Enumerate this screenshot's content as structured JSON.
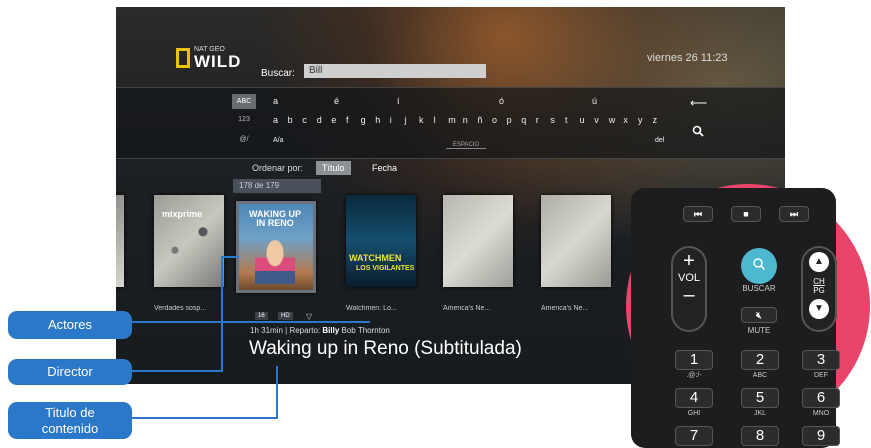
{
  "tv": {
    "channel_logo": {
      "small": "NAT GEO",
      "big": "WILD"
    },
    "search": {
      "label": "Buscar:",
      "value": "Bill"
    },
    "clock": "viernes 26  11:23",
    "keyboard": {
      "modes": [
        "ABC",
        "123",
        "@/"
      ],
      "row1": [
        "a",
        "é",
        "í",
        "ó",
        "ú"
      ],
      "row2": [
        "a",
        "b",
        "c",
        "d",
        "e",
        "f",
        "g",
        "h",
        "i",
        "j",
        "k",
        "l",
        "m",
        "n",
        "ñ",
        "o",
        "p",
        "q",
        "r",
        "s",
        "t",
        "u",
        "v",
        "w",
        "x",
        "y",
        "z"
      ],
      "row3_left": "A/a",
      "space_label": "ESPACIO",
      "row3_right": "del",
      "backspace_icon": "backspace-arrow-icon",
      "search_icon": "magnifier-icon"
    },
    "sort": {
      "label": "Ordenar por:",
      "options": [
        "Título",
        "Fecha"
      ],
      "selected": "Título"
    },
    "rail": {
      "counter": "178 de 179",
      "items": [
        {
          "title": "",
          "poster_text": ""
        },
        {
          "title": "Verdades sosp...",
          "poster_text": "mixprime"
        },
        {
          "title": "",
          "poster_text": "WAKING UP IN RENO"
        },
        {
          "title": "Watchmen: Lo...",
          "poster_text": "WATCHMEN",
          "poster_sub": "LOS VIGILANTES"
        },
        {
          "title": "America's Ne...",
          "poster_text": ""
        },
        {
          "title": "America's Ne...",
          "poster_text": ""
        },
        {
          "title": "",
          "poster_text": ""
        }
      ],
      "badges": [
        "16",
        "HD"
      ]
    },
    "details": {
      "duration": "1h 31min",
      "cast_label": "Reparto:",
      "cast_highlight": "Billy",
      "cast_rest": "Bob Thornton",
      "title": "Waking up in Reno (Subtitulada)"
    }
  },
  "remote": {
    "transport": {
      "rewind": "⏮",
      "stop": "■",
      "forward": "⏭"
    },
    "vol": {
      "plus": "+",
      "label": "VOL",
      "minus": "–"
    },
    "search": {
      "icon": "search-icon",
      "label": "BUSCAR"
    },
    "mute": {
      "icon": "mute-icon",
      "label": "MUTE"
    },
    "ch": {
      "up": "▲",
      "label_top": "CH",
      "label_bottom": "PG",
      "down": "▼"
    },
    "keys": [
      {
        "num": "1",
        "sub": ".@:/-"
      },
      {
        "num": "2",
        "sub": "ABC"
      },
      {
        "num": "3",
        "sub": "DEF"
      },
      {
        "num": "4",
        "sub": "GHI"
      },
      {
        "num": "5",
        "sub": "JKL"
      },
      {
        "num": "6",
        "sub": "MNO"
      },
      {
        "num": "7",
        "sub": ""
      },
      {
        "num": "8",
        "sub": ""
      },
      {
        "num": "9",
        "sub": ""
      }
    ]
  },
  "callouts": {
    "actors": "Actores",
    "director": "Director",
    "title_line1": "Titulo de",
    "title_line2": "contenido"
  },
  "colors": {
    "callout": "#2c78c8",
    "remote_accent": "#e9456b",
    "search_button": "#4db9d0",
    "natgeo_yellow": "#e8c300"
  }
}
